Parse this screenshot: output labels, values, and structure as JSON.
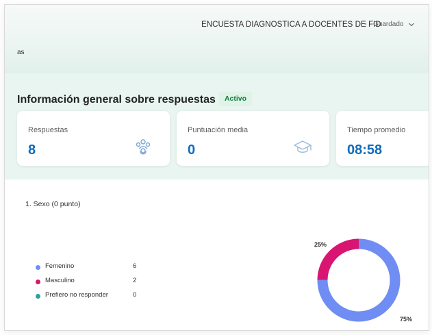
{
  "header": {
    "form_title": "ENCUESTA DIAGNOSTICA A DOCENTES DE FID",
    "separator": "-",
    "save_status": "Guardado",
    "tab_fragment": "as"
  },
  "summary": {
    "title": "Información general sobre respuestas",
    "status": "Activo"
  },
  "stats": [
    {
      "label": "Respuestas",
      "value": "8",
      "icon": "users-icon"
    },
    {
      "label": "Puntuación media",
      "value": "0",
      "icon": "graduation-cap-icon"
    },
    {
      "label": "Tiempo promedio",
      "value": "08:58",
      "icon": ""
    }
  ],
  "question": {
    "title": "1. Sexo (0 punto)",
    "legend": [
      {
        "label": "Femenino",
        "count": "6",
        "color": "#6f8df2"
      },
      {
        "label": "Masculino",
        "count": "2",
        "color": "#d91572"
      },
      {
        "label": "Prefiero no responder",
        "count": "0",
        "color": "#27a59c"
      }
    ]
  },
  "chart_data": {
    "type": "pie",
    "categories": [
      "Femenino",
      "Masculino",
      "Prefiero no responder"
    ],
    "values": [
      6,
      2,
      0
    ],
    "percent_labels": [
      "75%",
      "25%",
      ""
    ],
    "colors": [
      "#6f8df2",
      "#d91572",
      "#27a59c"
    ],
    "title": "1. Sexo (0 punto)"
  }
}
